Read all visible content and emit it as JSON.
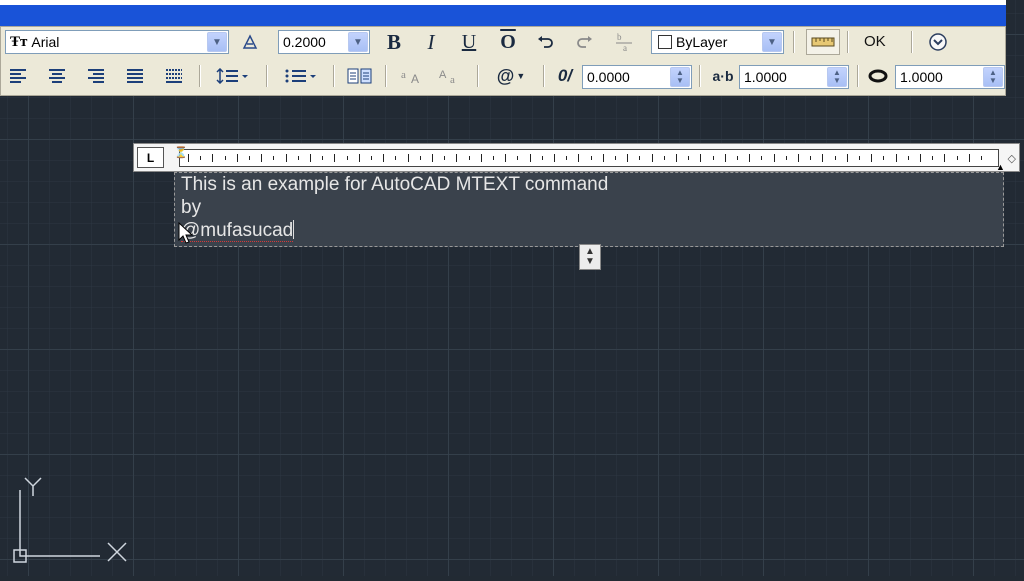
{
  "toolbar": {
    "font": {
      "icon": "truetype-font-icon",
      "value": "Arial"
    },
    "annotative_icon": "annotative-icon",
    "text_height": {
      "value": "0.2000"
    },
    "format": {
      "bold": "B",
      "italic": "I",
      "underline": "U",
      "overline": "O"
    },
    "undo_icon": "undo-icon",
    "redo_icon": "redo-icon",
    "stack_icon": "stack-icon",
    "color": {
      "value": "ByLayer"
    },
    "ruler_icon": "ruler-icon",
    "ok_label": "OK",
    "options_icon": "options-icon",
    "oblique": {
      "value": "0.0000"
    },
    "tracking": {
      "value": "1.0000"
    },
    "width_factor": {
      "value": "1.0000"
    },
    "symbol_label": "@"
  },
  "editor": {
    "lines": [
      "This is an example for AutoCAD MTEXT command",
      "by",
      "@mufasucad"
    ]
  },
  "ucs": {
    "x_label": "X",
    "y_label": "Y"
  },
  "colors": {
    "canvas": "#222a34",
    "titlebar": "#1953d8",
    "toolbar": "#ece9d8",
    "textbox": "#3a424c"
  }
}
